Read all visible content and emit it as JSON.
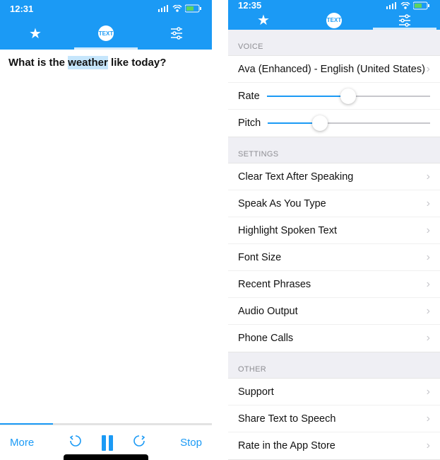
{
  "left": {
    "time": "12:31",
    "text_prefix": "What is the ",
    "text_highlight": "weather",
    "text_suffix": " like today?",
    "more": "More",
    "stop": "Stop",
    "progress_percent": 25,
    "text_badge": "TEXT"
  },
  "right": {
    "time": "12:35",
    "text_badge": "TEXT",
    "voice_header": "VOICE",
    "voice_name": "Ava (Enhanced) - English (United States)",
    "rate_label": "Rate",
    "rate_value": 50,
    "pitch_label": "Pitch",
    "pitch_value": 32,
    "settings_header": "SETTINGS",
    "settings_items": [
      "Clear Text After Speaking",
      "Speak As You Type",
      "Highlight Spoken Text",
      "Font Size",
      "Recent Phrases",
      "Audio Output",
      "Phone Calls"
    ],
    "other_header": "OTHER",
    "other_items": [
      "Support",
      "Share Text to Speech",
      "Rate in the App Store"
    ]
  }
}
